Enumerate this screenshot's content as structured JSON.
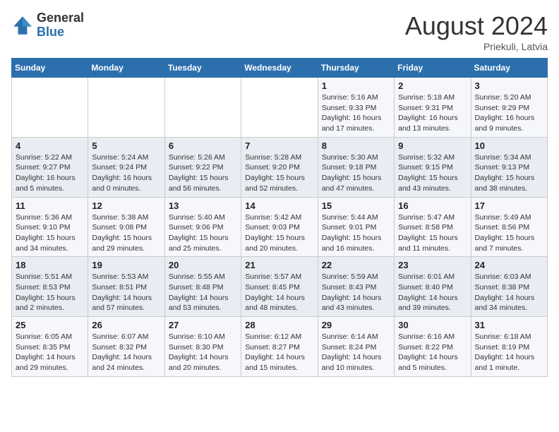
{
  "header": {
    "logo_general": "General",
    "logo_blue": "Blue",
    "month_year": "August 2024",
    "location": "Priekuli, Latvia"
  },
  "days_of_week": [
    "Sunday",
    "Monday",
    "Tuesday",
    "Wednesday",
    "Thursday",
    "Friday",
    "Saturday"
  ],
  "weeks": [
    [
      {
        "day": "",
        "info": ""
      },
      {
        "day": "",
        "info": ""
      },
      {
        "day": "",
        "info": ""
      },
      {
        "day": "",
        "info": ""
      },
      {
        "day": "1",
        "info": "Sunrise: 5:16 AM\nSunset: 9:33 PM\nDaylight: 16 hours\nand 17 minutes."
      },
      {
        "day": "2",
        "info": "Sunrise: 5:18 AM\nSunset: 9:31 PM\nDaylight: 16 hours\nand 13 minutes."
      },
      {
        "day": "3",
        "info": "Sunrise: 5:20 AM\nSunset: 9:29 PM\nDaylight: 16 hours\nand 9 minutes."
      }
    ],
    [
      {
        "day": "4",
        "info": "Sunrise: 5:22 AM\nSunset: 9:27 PM\nDaylight: 16 hours\nand 5 minutes."
      },
      {
        "day": "5",
        "info": "Sunrise: 5:24 AM\nSunset: 9:24 PM\nDaylight: 16 hours\nand 0 minutes."
      },
      {
        "day": "6",
        "info": "Sunrise: 5:26 AM\nSunset: 9:22 PM\nDaylight: 15 hours\nand 56 minutes."
      },
      {
        "day": "7",
        "info": "Sunrise: 5:28 AM\nSunset: 9:20 PM\nDaylight: 15 hours\nand 52 minutes."
      },
      {
        "day": "8",
        "info": "Sunrise: 5:30 AM\nSunset: 9:18 PM\nDaylight: 15 hours\nand 47 minutes."
      },
      {
        "day": "9",
        "info": "Sunrise: 5:32 AM\nSunset: 9:15 PM\nDaylight: 15 hours\nand 43 minutes."
      },
      {
        "day": "10",
        "info": "Sunrise: 5:34 AM\nSunset: 9:13 PM\nDaylight: 15 hours\nand 38 minutes."
      }
    ],
    [
      {
        "day": "11",
        "info": "Sunrise: 5:36 AM\nSunset: 9:10 PM\nDaylight: 15 hours\nand 34 minutes."
      },
      {
        "day": "12",
        "info": "Sunrise: 5:38 AM\nSunset: 9:08 PM\nDaylight: 15 hours\nand 29 minutes."
      },
      {
        "day": "13",
        "info": "Sunrise: 5:40 AM\nSunset: 9:06 PM\nDaylight: 15 hours\nand 25 minutes."
      },
      {
        "day": "14",
        "info": "Sunrise: 5:42 AM\nSunset: 9:03 PM\nDaylight: 15 hours\nand 20 minutes."
      },
      {
        "day": "15",
        "info": "Sunrise: 5:44 AM\nSunset: 9:01 PM\nDaylight: 15 hours\nand 16 minutes."
      },
      {
        "day": "16",
        "info": "Sunrise: 5:47 AM\nSunset: 8:58 PM\nDaylight: 15 hours\nand 11 minutes."
      },
      {
        "day": "17",
        "info": "Sunrise: 5:49 AM\nSunset: 8:56 PM\nDaylight: 15 hours\nand 7 minutes."
      }
    ],
    [
      {
        "day": "18",
        "info": "Sunrise: 5:51 AM\nSunset: 8:53 PM\nDaylight: 15 hours\nand 2 minutes."
      },
      {
        "day": "19",
        "info": "Sunrise: 5:53 AM\nSunset: 8:51 PM\nDaylight: 14 hours\nand 57 minutes."
      },
      {
        "day": "20",
        "info": "Sunrise: 5:55 AM\nSunset: 8:48 PM\nDaylight: 14 hours\nand 53 minutes."
      },
      {
        "day": "21",
        "info": "Sunrise: 5:57 AM\nSunset: 8:45 PM\nDaylight: 14 hours\nand 48 minutes."
      },
      {
        "day": "22",
        "info": "Sunrise: 5:59 AM\nSunset: 8:43 PM\nDaylight: 14 hours\nand 43 minutes."
      },
      {
        "day": "23",
        "info": "Sunrise: 6:01 AM\nSunset: 8:40 PM\nDaylight: 14 hours\nand 39 minutes."
      },
      {
        "day": "24",
        "info": "Sunrise: 6:03 AM\nSunset: 8:38 PM\nDaylight: 14 hours\nand 34 minutes."
      }
    ],
    [
      {
        "day": "25",
        "info": "Sunrise: 6:05 AM\nSunset: 8:35 PM\nDaylight: 14 hours\nand 29 minutes."
      },
      {
        "day": "26",
        "info": "Sunrise: 6:07 AM\nSunset: 8:32 PM\nDaylight: 14 hours\nand 24 minutes."
      },
      {
        "day": "27",
        "info": "Sunrise: 6:10 AM\nSunset: 8:30 PM\nDaylight: 14 hours\nand 20 minutes."
      },
      {
        "day": "28",
        "info": "Sunrise: 6:12 AM\nSunset: 8:27 PM\nDaylight: 14 hours\nand 15 minutes."
      },
      {
        "day": "29",
        "info": "Sunrise: 6:14 AM\nSunset: 8:24 PM\nDaylight: 14 hours\nand 10 minutes."
      },
      {
        "day": "30",
        "info": "Sunrise: 6:16 AM\nSunset: 8:22 PM\nDaylight: 14 hours\nand 5 minutes."
      },
      {
        "day": "31",
        "info": "Sunrise: 6:18 AM\nSunset: 8:19 PM\nDaylight: 14 hours\nand 1 minute."
      }
    ]
  ]
}
